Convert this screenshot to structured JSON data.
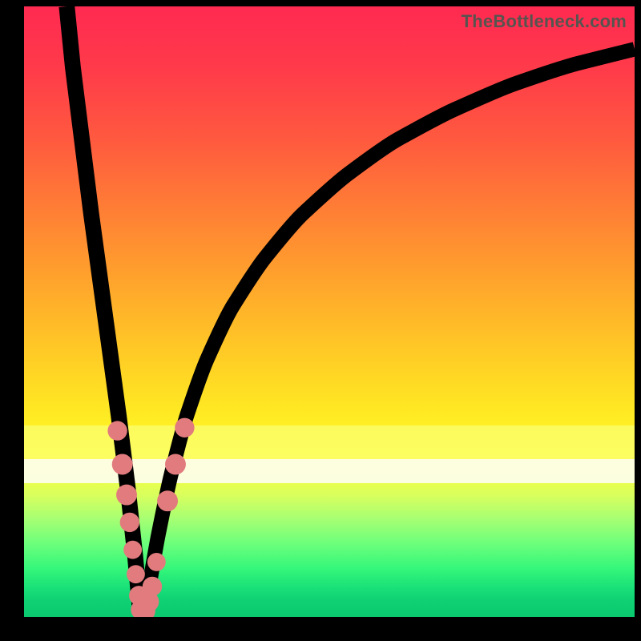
{
  "watermark": "TheBottleneck.com",
  "colors": {
    "marker": "#e17b7d",
    "curve": "#000000"
  },
  "chart_data": {
    "type": "line",
    "title": "",
    "xlabel": "",
    "ylabel": "",
    "xlim": [
      0,
      100
    ],
    "ylim": [
      0,
      100
    ],
    "grid": false,
    "legend": false,
    "note": "Axes are unlabeled in the source image; values below are estimated from pixel geometry on a 0–100 normalized scale (origin at bottom-left of the gradient area). The curve is a V-shaped bottleneck curve with its minimum near x≈19, y≈0.",
    "series": [
      {
        "name": "left-branch",
        "x": [
          7.0,
          8.0,
          9.5,
          11.0,
          12.5,
          14.0,
          15.5,
          17.0,
          18.2,
          19.0
        ],
        "y": [
          100.0,
          90.0,
          78.0,
          66.0,
          55.0,
          44.0,
          33.0,
          21.0,
          10.0,
          1.0
        ]
      },
      {
        "name": "right-branch",
        "x": [
          20.0,
          21.5,
          23.5,
          26.0,
          29.0,
          33.0,
          38.0,
          44.0,
          51.0,
          59.0,
          68.0,
          78.0,
          88.0,
          100.0
        ],
        "y": [
          2.0,
          11.0,
          21.0,
          31.0,
          40.0,
          49.0,
          57.0,
          64.5,
          71.0,
          77.0,
          82.0,
          86.5,
          90.0,
          93.0
        ]
      }
    ],
    "markers": {
      "name": "highlighted-points",
      "color": "#e17b7d",
      "points": [
        {
          "x": 15.3,
          "y": 30.5,
          "r": 1.6
        },
        {
          "x": 16.1,
          "y": 25.0,
          "r": 1.7
        },
        {
          "x": 16.8,
          "y": 20.0,
          "r": 1.7
        },
        {
          "x": 17.3,
          "y": 15.5,
          "r": 1.6
        },
        {
          "x": 17.8,
          "y": 11.0,
          "r": 1.5
        },
        {
          "x": 18.3,
          "y": 7.0,
          "r": 1.5
        },
        {
          "x": 18.8,
          "y": 3.5,
          "r": 1.6
        },
        {
          "x": 19.2,
          "y": 1.2,
          "r": 1.7
        },
        {
          "x": 19.8,
          "y": 1.0,
          "r": 1.7
        },
        {
          "x": 20.4,
          "y": 2.5,
          "r": 1.7
        },
        {
          "x": 21.0,
          "y": 5.0,
          "r": 1.6
        },
        {
          "x": 21.7,
          "y": 9.0,
          "r": 1.5
        },
        {
          "x": 23.5,
          "y": 19.0,
          "r": 1.7
        },
        {
          "x": 24.8,
          "y": 25.0,
          "r": 1.7
        },
        {
          "x": 26.3,
          "y": 31.0,
          "r": 1.6
        }
      ]
    }
  }
}
